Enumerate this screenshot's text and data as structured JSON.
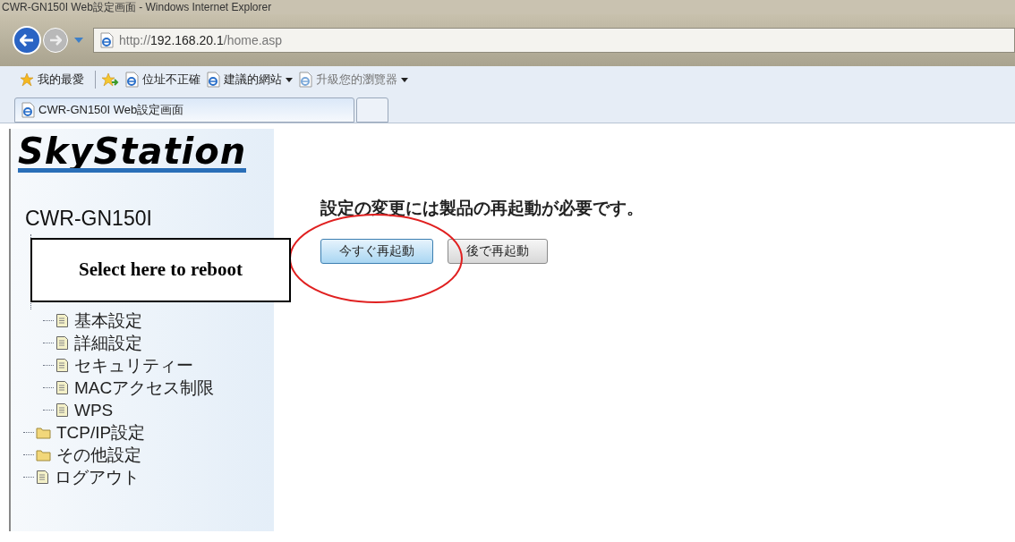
{
  "window": {
    "title": "CWR-GN150I Web設定画面 - Windows Internet Explorer"
  },
  "address_bar": {
    "url_host": "http://192.168.20.1",
    "url_path": "/home.asp"
  },
  "favorites_bar": [
    {
      "kind": "favorites",
      "label": "我的最愛",
      "dropdown": false
    },
    {
      "kind": "add",
      "dropdown": false
    },
    {
      "kind": "page",
      "label": "位址不正確",
      "dropdown": false
    },
    {
      "kind": "page",
      "label": "建議的網站",
      "dropdown": true
    },
    {
      "kind": "page",
      "label": "升級您的瀏覽器",
      "dropdown": true
    }
  ],
  "tabs": [
    {
      "label": "CWR-GN150I Web設定画面",
      "selected": true
    }
  ],
  "sidebar": {
    "logo": "SkyStation",
    "model": "CWR-GN150I",
    "tree": [
      {
        "children": [
          {
            "kind": "page",
            "label": "基本設定"
          },
          {
            "kind": "page",
            "label": "詳細設定"
          },
          {
            "kind": "page",
            "label": "セキュリティー"
          },
          {
            "kind": "page",
            "label": "MACアクセス制限"
          },
          {
            "kind": "page",
            "label": "WPS"
          }
        ]
      },
      {
        "kind": "folder",
        "label": "TCP/IP設定"
      },
      {
        "kind": "folder",
        "label": "その他設定"
      },
      {
        "kind": "page",
        "label": "ログアウト"
      }
    ]
  },
  "main": {
    "message": "設定の変更には製品の再起動が必要です。",
    "buttons": [
      {
        "label": "今すぐ再起動",
        "highlighted": true
      },
      {
        "label": "後で再起動",
        "highlighted": false
      }
    ]
  },
  "annotation": {
    "text": "Select here to reboot"
  }
}
